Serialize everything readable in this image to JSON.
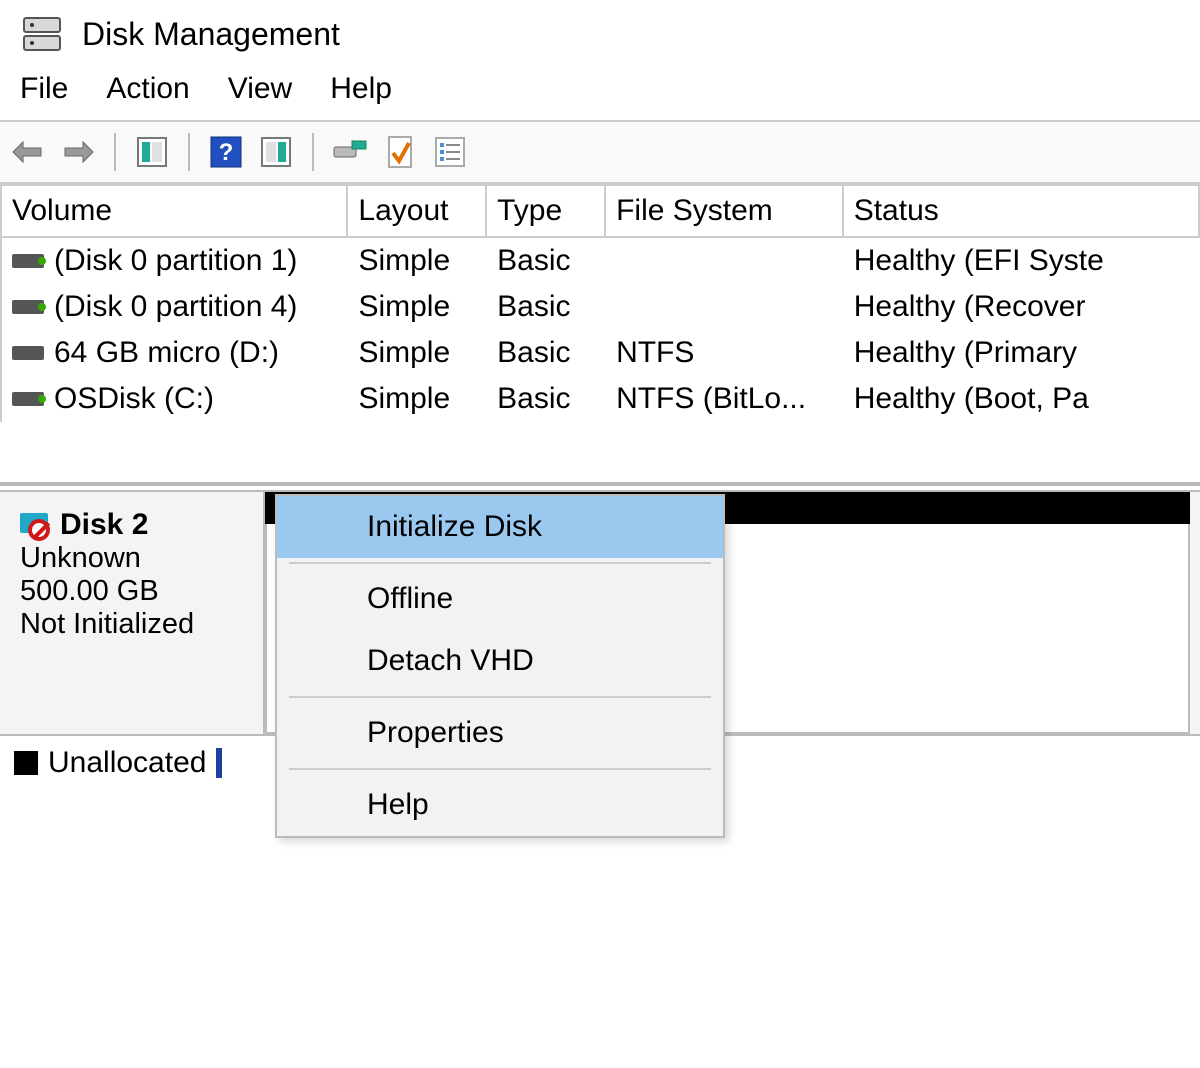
{
  "window": {
    "title": "Disk Management"
  },
  "menu": {
    "file": "File",
    "action": "Action",
    "view": "View",
    "help": "Help"
  },
  "columns": {
    "c0": "Volume",
    "c1": "Layout",
    "c2": "Type",
    "c3": "File System",
    "c4": "Status"
  },
  "volumes": [
    {
      "icon": "green",
      "name": "(Disk 0 partition 1)",
      "layout": "Simple",
      "type": "Basic",
      "fs": "",
      "status": "Healthy (EFI Syste"
    },
    {
      "icon": "green",
      "name": "(Disk 0 partition 4)",
      "layout": "Simple",
      "type": "Basic",
      "fs": "",
      "status": "Healthy (Recover"
    },
    {
      "icon": "",
      "name": "64 GB micro (D:)",
      "layout": "Simple",
      "type": "Basic",
      "fs": "NTFS",
      "status": "Healthy (Primary"
    },
    {
      "icon": "green",
      "name": "OSDisk (C:)",
      "layout": "Simple",
      "type": "Basic",
      "fs": "NTFS (BitLo...",
      "status": "Healthy (Boot, Pa"
    }
  ],
  "disk": {
    "name": "Disk 2",
    "kind": "Unknown",
    "size": "500.00 GB",
    "state": "Not Initialized"
  },
  "context_menu": {
    "initialize": "Initialize Disk",
    "offline": "Offline",
    "detach": "Detach VHD",
    "properties": "Properties",
    "help": "Help"
  },
  "legend": {
    "unallocated": "Unallocated"
  }
}
